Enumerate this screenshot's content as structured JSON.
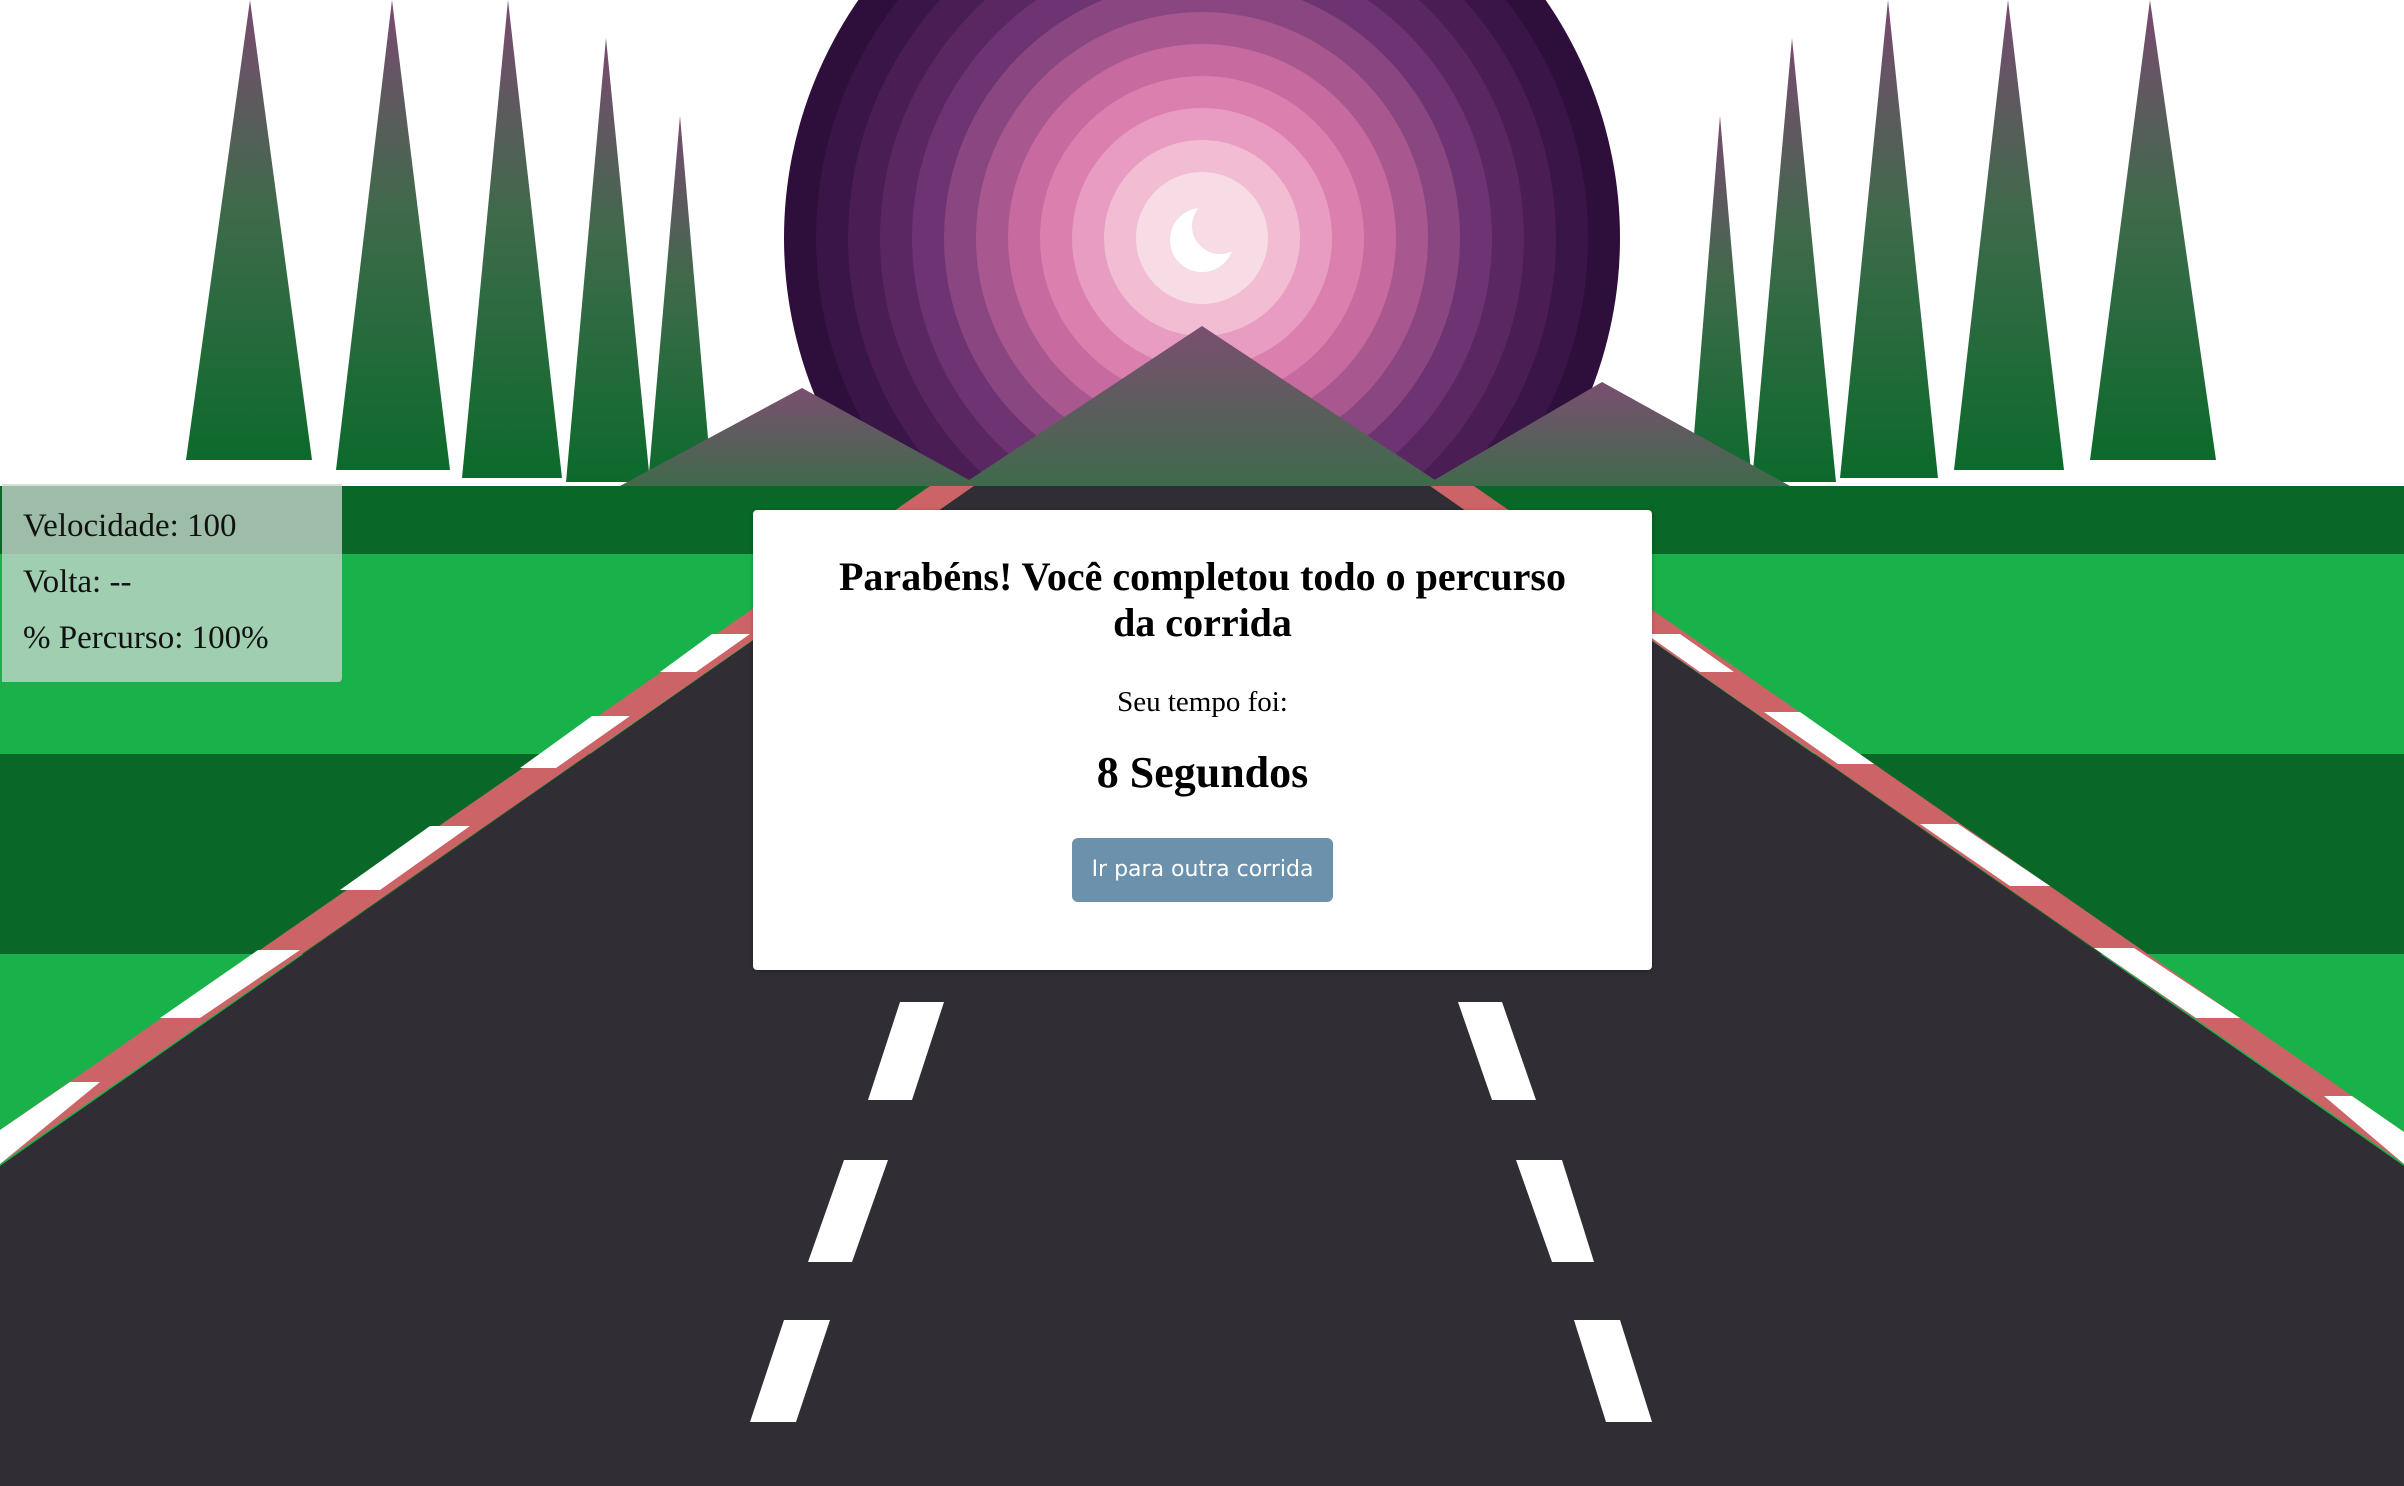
{
  "hud": {
    "speed_text": "Velocidade: 100",
    "lap_text": "Volta: --",
    "progress_text": "% Percurso: 100%"
  },
  "modal": {
    "title": "Parabéns! Você completou todo o percurso da corrida",
    "time_label": "Seu tempo foi:",
    "time_value": "8 Segundos",
    "button_label": "Ir para outra corrida"
  },
  "colors": {
    "grass_light": "#19b149",
    "grass_dark": "#096727",
    "road": "#302d34",
    "rumble_red": "#cc6467",
    "rumble_white": "#ffffff",
    "lane_marker": "#ffffff",
    "button": "#6b91ad"
  },
  "icons": {
    "moon": "crescent-moon-icon"
  }
}
